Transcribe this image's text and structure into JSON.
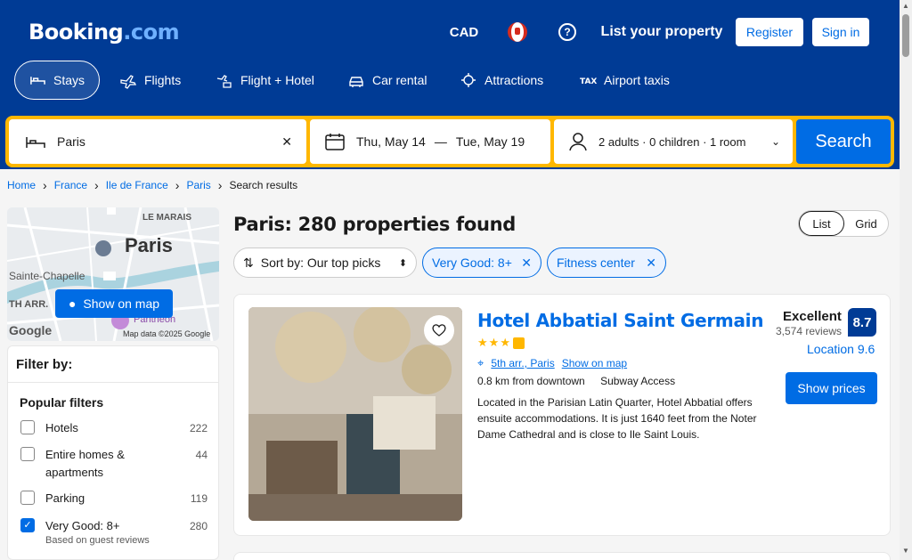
{
  "header": {
    "logo_main": "Booking",
    "logo_suffix": ".com",
    "currency": "CAD",
    "list_property": "List your property",
    "register": "Register",
    "sign_in": "Sign in"
  },
  "nav": {
    "stays": "Stays",
    "flights": "Flights",
    "flight_hotel": "Flight + Hotel",
    "car_rental": "Car rental",
    "attractions": "Attractions",
    "airport_taxis": "Airport taxis"
  },
  "search": {
    "destination": "Paris",
    "check_in": "Thu, May 14",
    "dash": "—",
    "check_out": "Tue, May 19",
    "guests": "2 adults · 0 children · 1 room",
    "search_button": "Search"
  },
  "breadcrumb": [
    "Home",
    "France",
    "Ile de France",
    "Paris",
    "Search results"
  ],
  "map": {
    "label_marais": "LE MARAIS",
    "label_paris": "Paris",
    "label_chapelle": "Sainte-Chapelle",
    "label_th_arr": "TH ARR.",
    "label_pantheon": "Panthéon",
    "credit": "Map data ©2025 Google",
    "google": "Google",
    "show_on_map": "Show on map"
  },
  "filters": {
    "title": "Filter by:",
    "section": "Popular filters",
    "options": [
      {
        "label": "Hotels",
        "count": "222",
        "checked": false
      },
      {
        "label": "Entire homes & apartments",
        "count": "44",
        "checked": false
      },
      {
        "label": "Parking",
        "count": "119",
        "checked": false
      },
      {
        "label": "Very Good: 8+",
        "count": "280",
        "checked": true,
        "sub": "Based on guest reviews"
      }
    ]
  },
  "results": {
    "title": "Paris: 280 properties found",
    "view_list": "List",
    "view_grid": "Grid",
    "sort_label": "Sort by: Our top picks",
    "chip_rating": "Very Good: 8+",
    "chip_fitness": "Fitness center"
  },
  "hotel": {
    "name": "Hotel Abbatial Saint Germain",
    "area": "5th arr., Paris",
    "show_on_map": "Show on map",
    "distance": "0.8 km from downtown",
    "transit": "Subway Access",
    "description": "Located in the Parisian Latin Quarter, Hotel Abbatial offers ensuite accommodations. It is just 1640 feet from the Noter Dame Cathedral and is close to Ile Saint Louis.",
    "rating_word": "Excellent",
    "reviews": "3,574 reviews",
    "score": "8.7",
    "location_score": "Location 9.6",
    "show_prices": "Show prices",
    "stars": 3
  },
  "colors": {
    "brand_blue": "#003b95",
    "link_blue": "#006ce4",
    "search_yellow": "#ffb700"
  }
}
